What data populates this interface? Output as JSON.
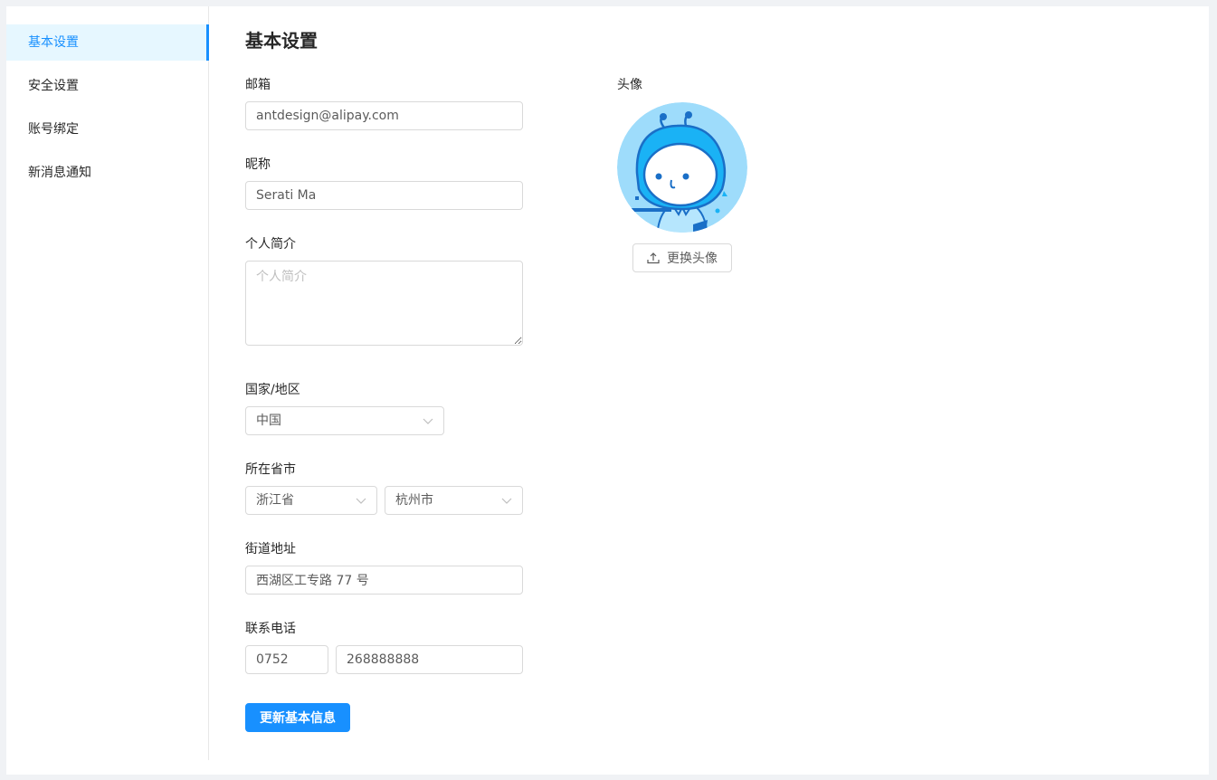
{
  "sidebar": {
    "items": [
      {
        "label": "基本设置",
        "active": true
      },
      {
        "label": "安全设置",
        "active": false
      },
      {
        "label": "账号绑定",
        "active": false
      },
      {
        "label": "新消息通知",
        "active": false
      }
    ]
  },
  "main": {
    "title": "基本设置",
    "email": {
      "label": "邮箱",
      "value": "antdesign@alipay.com"
    },
    "nickname": {
      "label": "昵称",
      "value": "Serati Ma"
    },
    "bio": {
      "label": "个人简介",
      "placeholder": "个人简介",
      "value": ""
    },
    "country": {
      "label": "国家/地区",
      "value": "中国"
    },
    "region": {
      "label": "所在省市",
      "province": "浙江省",
      "city": "杭州市"
    },
    "address": {
      "label": "街道地址",
      "value": "西湖区工专路 77 号"
    },
    "phone": {
      "label": "联系电话",
      "area_code": "0752",
      "number": "268888888"
    },
    "submit_label": "更新基本信息"
  },
  "avatar": {
    "label": "头像",
    "change_label": "更换头像",
    "icon": "upload-icon"
  },
  "colors": {
    "primary": "#1890ff",
    "active_bg": "#e6f7ff",
    "border": "#d9d9d9"
  }
}
